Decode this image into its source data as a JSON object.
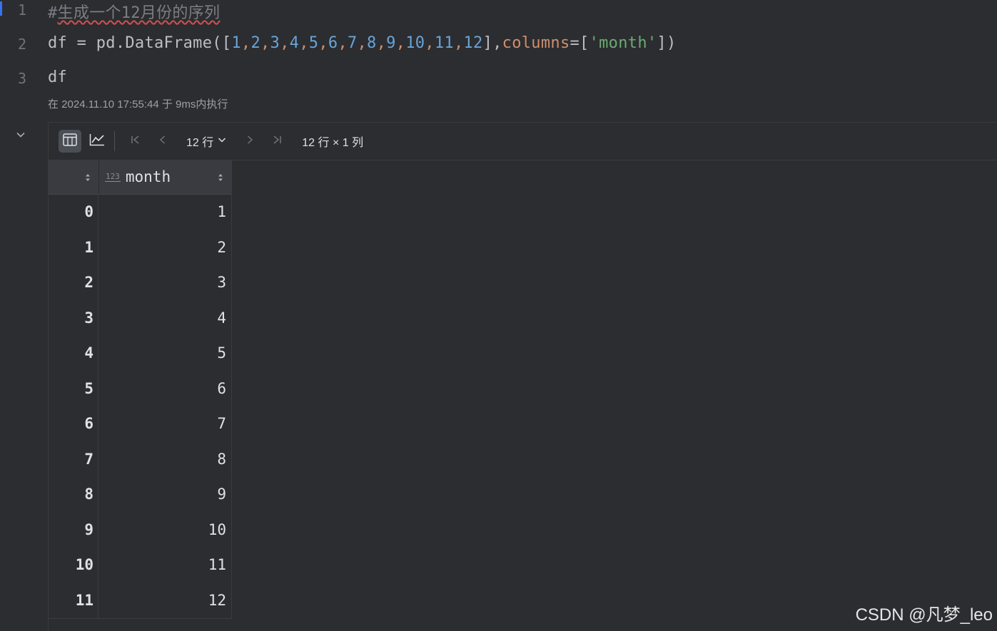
{
  "editor": {
    "line_numbers": [
      "1",
      "2",
      "3"
    ],
    "comment_prefix": "#",
    "comment_text": "生成一个12月份的序列",
    "code_line2": {
      "prefix": "df = pd.DataFrame([",
      "numbers": [
        "1",
        "2",
        "3",
        "4",
        "5",
        "6",
        "7",
        "8",
        "9",
        "10",
        "11",
        "12"
      ],
      "sep": ",",
      "after_list": "],",
      "kwarg": "columns",
      "eq": "=[",
      "string": "'month'",
      "suffix": "])"
    },
    "code_line3": "df",
    "exec_info": "在 2024.11.10 17:55:44 于 9ms内执行"
  },
  "output": {
    "toolbar": {
      "rows_label": "12 行",
      "dims_label": "12 行 × 1 列"
    },
    "table": {
      "type_badge": "123",
      "column_name": "month",
      "index": [
        "0",
        "1",
        "2",
        "3",
        "4",
        "5",
        "6",
        "7",
        "8",
        "9",
        "10",
        "11"
      ],
      "values": [
        "1",
        "2",
        "3",
        "4",
        "5",
        "6",
        "7",
        "8",
        "9",
        "10",
        "11",
        "12"
      ]
    }
  },
  "watermark": "CSDN @凡梦_leo"
}
